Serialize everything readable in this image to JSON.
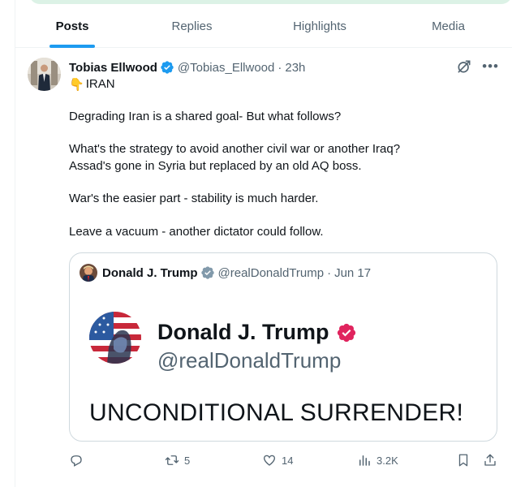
{
  "tabs": [
    {
      "label": "Posts",
      "active": true
    },
    {
      "label": "Replies",
      "active": false
    },
    {
      "label": "Highlights",
      "active": false
    },
    {
      "label": "Media",
      "active": false
    }
  ],
  "tweet": {
    "author_name": "Tobias Ellwood",
    "handle": "@Tobias_Ellwood",
    "separator": "·",
    "time": "23h",
    "more_icon": "more-dots-icon",
    "emoji": "👇",
    "lines": [
      "IRAN",
      "Degrading Iran is a shared goal- But what follows?",
      "What's the strategy to avoid another civil war or another Iraq?",
      "Assad's gone in Syria but replaced by an old AQ boss.",
      "War's the easier part - stability is much harder.",
      "Leave a vacuum - another dictator could follow."
    ],
    "quote": {
      "author_name": "Donald J. Trump",
      "handle": "@realDonaldTrump",
      "separator": "·",
      "date": "Jun 17",
      "image": {
        "name": "Donald J. Trump",
        "handle": "@realDonaldTrump",
        "text": "UNCONDITIONAL SURRENDER!"
      }
    },
    "actions": {
      "reposts": "5",
      "likes": "14",
      "views": "3.2K"
    }
  },
  "colors": {
    "accent": "#1d9bf0",
    "secondary_text": "#536471",
    "border": "#cfd9de",
    "verified_gold": "#e0245e",
    "top_banner": "#dcf2e6"
  }
}
